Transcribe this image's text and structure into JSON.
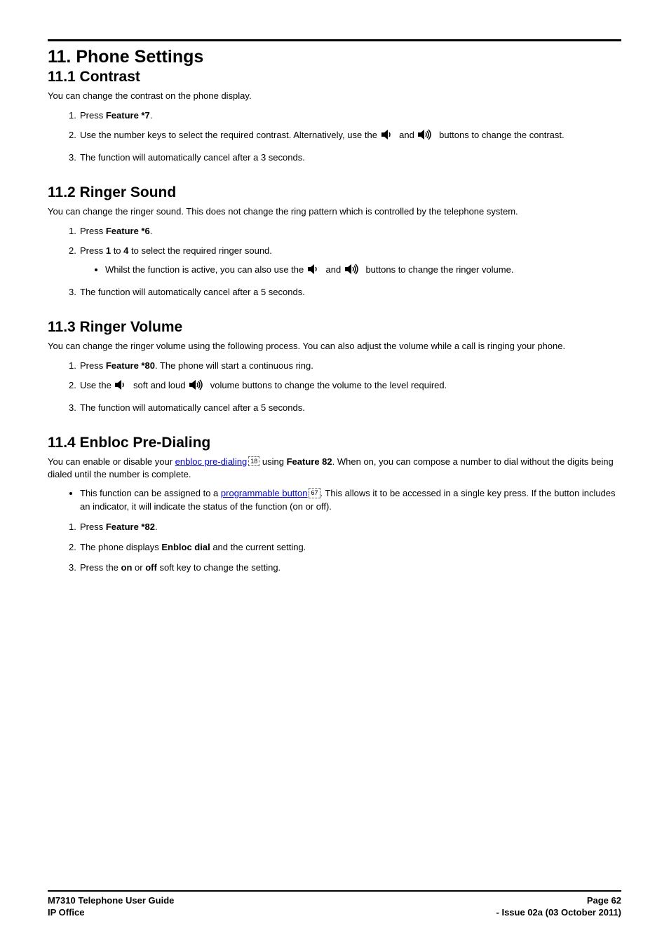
{
  "chapter": {
    "title": "11. Phone Settings"
  },
  "s1": {
    "heading": "11.1 Contrast",
    "intro": "You can change the contrast on the phone display.",
    "step1_pre": "Press ",
    "step1_bold": "Feature *7",
    "step1_post": ".",
    "step2_pre": "Use the number keys to select the required contrast. Alternatively, use the ",
    "step2_mid": " and ",
    "step2_post": " buttons to change the contrast.",
    "step3": "The function will automatically cancel after a 3 seconds."
  },
  "s2": {
    "heading": "11.2 Ringer Sound",
    "intro": "You can change the ringer sound. This does not change the ring pattern which is controlled by the telephone system.",
    "step1_pre": "Press ",
    "step1_bold": "Feature *6",
    "step1_post": ".",
    "step2_a": "Press ",
    "step2_b": "1",
    "step2_c": " to ",
    "step2_d": "4",
    "step2_e": " to select the required ringer sound.",
    "sub_pre": "Whilst the function is active, you can also use the ",
    "sub_mid": " and ",
    "sub_post": " buttons to change the ringer volume.",
    "step3": "The function will automatically cancel after a 5 seconds."
  },
  "s3": {
    "heading": "11.3 Ringer Volume",
    "intro": "You can change the ringer volume using the following process. You can also adjust the volume while a call is ringing your phone.",
    "step1_pre": "Press ",
    "step1_bold": "Feature *80",
    "step1_post": ". The phone will start a continuous ring.",
    "step2_pre": "Use the ",
    "step2_mid1": " soft and loud ",
    "step2_post": " volume buttons to change the volume to the level required.",
    "step3": "The function will automatically cancel after a 5 seconds."
  },
  "s4": {
    "heading": "11.4 Enbloc Pre-Dialing",
    "intro_a": "You can enable or disable your ",
    "link1": "enbloc pre-dialing",
    "ref1": "18",
    "intro_b": " using ",
    "intro_bold": "Feature 82",
    "intro_c": ". When on, you can compose a number to dial without the digits being dialed until the number is complete.",
    "bullet_a": "This function can be assigned to a ",
    "link2": "programmable button",
    "ref2": "67",
    "bullet_b": ". This allows it to be accessed in a single key press. If the button includes an indicator, it will indicate the status of the function (on or off).",
    "step1_pre": "Press ",
    "step1_bold": "Feature *82",
    "step1_post": ".",
    "step2_a": "The phone displays ",
    "step2_bold": "Enbloc dial",
    "step2_b": " and the current setting.",
    "step3_a": "Press the ",
    "step3_b": "on",
    "step3_c": " or ",
    "step3_d": "off",
    "step3_e": " soft key to change the setting."
  },
  "footer": {
    "left1": "M7310 Telephone User Guide",
    "left2": "IP Office",
    "right1": "Page 62",
    "right2": "- Issue 02a (03 October 2011)"
  }
}
